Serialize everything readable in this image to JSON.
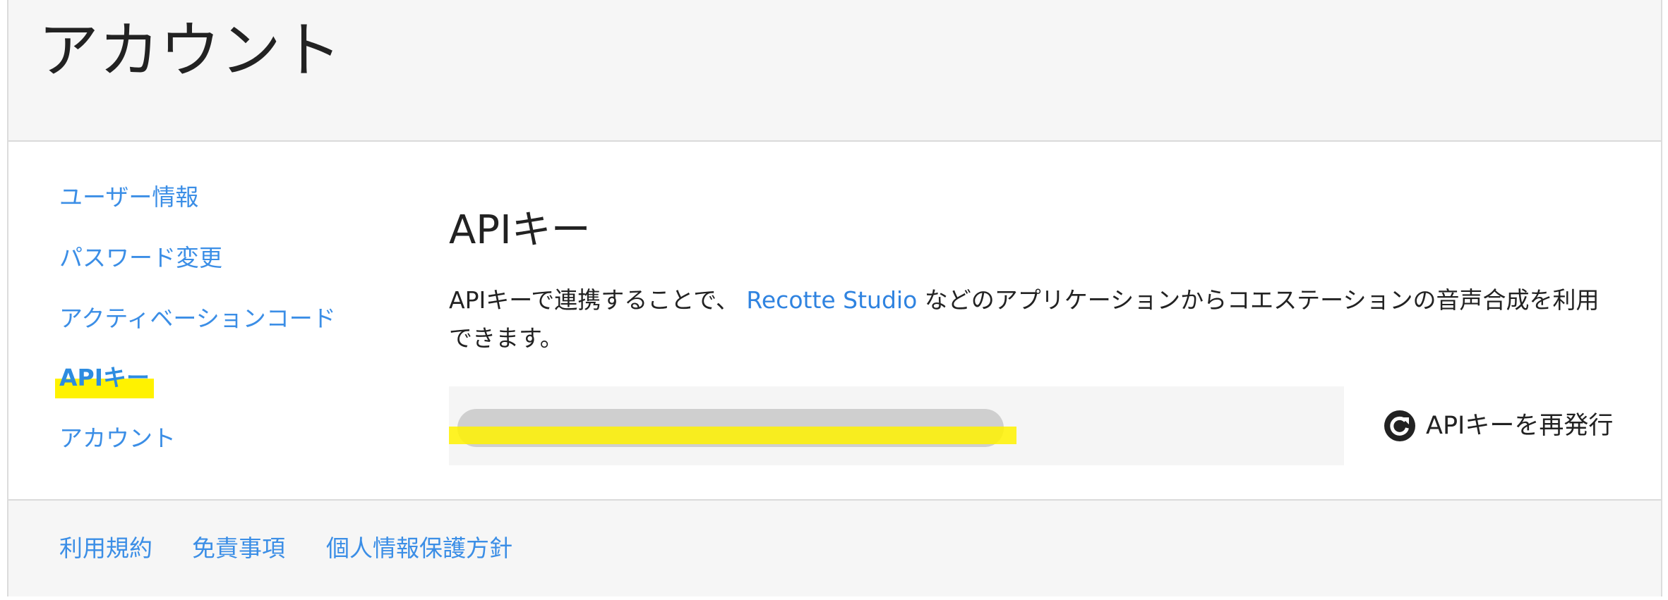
{
  "header": {
    "title": "アカウント"
  },
  "sidebar": {
    "items": [
      {
        "label": "ユーザー情報",
        "active": false
      },
      {
        "label": "パスワード変更",
        "active": false
      },
      {
        "label": "アクティベーションコード",
        "active": false
      },
      {
        "label": "APIキー",
        "active": true
      },
      {
        "label": "アカウント",
        "active": false
      }
    ]
  },
  "main": {
    "section_title": "APIキー",
    "description_before": "APIキーで連携することで、 ",
    "description_link": "Recotte Studio",
    "description_after": " などのアプリケーションからコエステーションの音声合成を利用できます。",
    "api_key_value": "",
    "regenerate_label": "APIキーを再発行",
    "regenerate_icon": "refresh-icon"
  },
  "footer": {
    "links": [
      {
        "label": "利用規約"
      },
      {
        "label": "免責事項"
      },
      {
        "label": "個人情報保護方針"
      }
    ]
  },
  "colors": {
    "link": "#3b8ee6",
    "highlight": "#fff200",
    "header_bg": "#f6f6f6",
    "masked_key": "#cfcfcf"
  }
}
